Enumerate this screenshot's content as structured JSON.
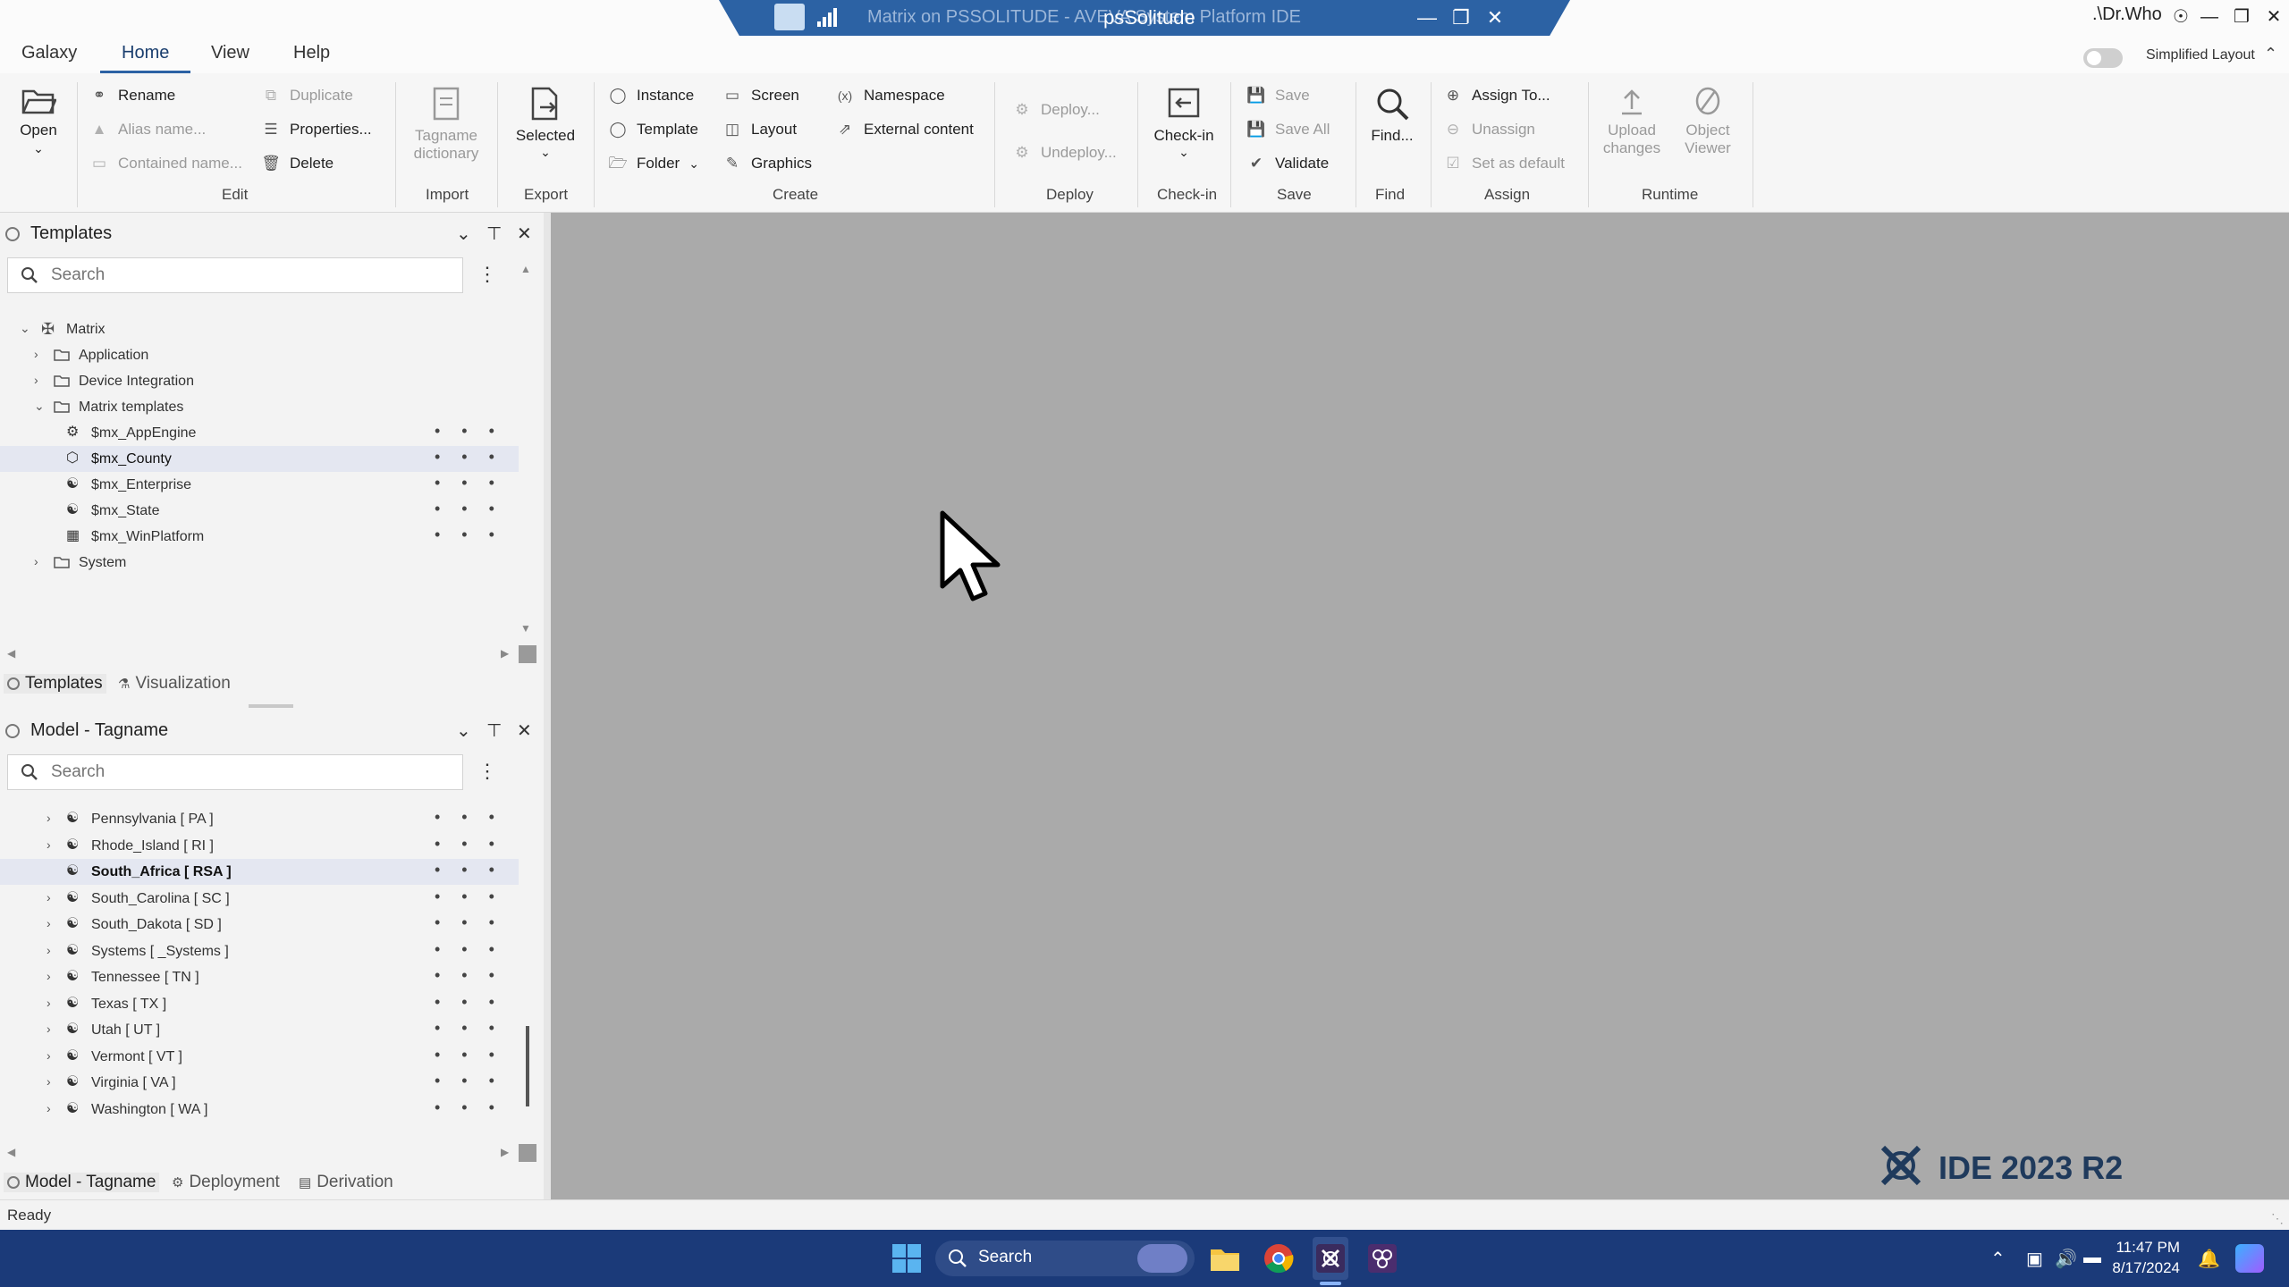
{
  "titlebar": {
    "bg_title": "Matrix on PSSOLITUDE - AVEVA System Platform IDE",
    "main_title": "psSolitude",
    "user": ".\\Dr.Who"
  },
  "menu": {
    "items": [
      "Galaxy",
      "Home",
      "View",
      "Help"
    ],
    "active": "Home",
    "simplified_layout": "Simplified Layout"
  },
  "ribbon": {
    "open": "Open",
    "edit": {
      "rename": "Rename",
      "alias_name": "Alias name...",
      "contained_name": "Contained name...",
      "duplicate": "Duplicate",
      "properties": "Properties...",
      "delete": "Delete",
      "label": "Edit"
    },
    "import": {
      "tagname_dictionary_1": "Tagname",
      "tagname_dictionary_2": "dictionary",
      "label": "Import"
    },
    "export": {
      "selected": "Selected",
      "label": "Export"
    },
    "create": {
      "instance": "Instance",
      "template": "Template",
      "folder": "Folder",
      "screen": "Screen",
      "layout": "Layout",
      "graphics": "Graphics",
      "namespace": "Namespace",
      "external_content": "External content",
      "label": "Create"
    },
    "deploy": {
      "deploy": "Deploy...",
      "undeploy": "Undeploy...",
      "label": "Deploy"
    },
    "checkin": {
      "checkin": "Check-in",
      "label": "Check-in"
    },
    "save": {
      "save": "Save",
      "save_all": "Save All",
      "validate": "Validate",
      "label": "Save"
    },
    "find": {
      "find": "Find...",
      "label": "Find"
    },
    "assign": {
      "assign_to": "Assign To...",
      "unassign": "Unassign",
      "set_default": "Set as default",
      "label": "Assign"
    },
    "runtime": {
      "upload_1": "Upload",
      "upload_2": "changes",
      "object_1": "Object",
      "object_2": "Viewer",
      "label": "Runtime"
    }
  },
  "templates_panel": {
    "title": "Templates",
    "search_placeholder": "Search",
    "tree": [
      {
        "label": "Matrix"
      },
      {
        "label": "Application"
      },
      {
        "label": "Device Integration"
      },
      {
        "label": "Matrix templates"
      },
      {
        "label": "$mx_AppEngine"
      },
      {
        "label": "$mx_County"
      },
      {
        "label": "$mx_Enterprise"
      },
      {
        "label": "$mx_State"
      },
      {
        "label": "$mx_WinPlatform"
      },
      {
        "label": "System"
      }
    ],
    "tabs": [
      "Templates",
      "Visualization"
    ]
  },
  "model_panel": {
    "title": "Model - Tagname",
    "search_placeholder": "Search",
    "tree": [
      {
        "label": "Pennsylvania [ PA ]"
      },
      {
        "label": "Rhode_Island [ RI ]"
      },
      {
        "label": "South_Africa [ RSA ]"
      },
      {
        "label": "South_Carolina [ SC ]"
      },
      {
        "label": "South_Dakota [ SD ]"
      },
      {
        "label": "Systems [ _Systems ]"
      },
      {
        "label": "Tennessee [ TN ]"
      },
      {
        "label": "Texas [ TX ]"
      },
      {
        "label": "Utah [ UT ]"
      },
      {
        "label": "Vermont [ VT ]"
      },
      {
        "label": "Virginia [ VA ]"
      },
      {
        "label": "Washington [ WA ]"
      }
    ],
    "tabs": [
      "Model - Tagname",
      "Deployment",
      "Derivation"
    ]
  },
  "canvas": {
    "badge": "IDE 2023 R2"
  },
  "status": {
    "text": "Ready"
  },
  "taskbar": {
    "search": "Search",
    "time": "11:47 PM",
    "date": "8/17/2024"
  },
  "colors": {
    "accent": "#2c62a4",
    "canvas": "#aaaaaa",
    "taskbar": "#1b3a79",
    "selected_row": "#e4e7f1"
  }
}
